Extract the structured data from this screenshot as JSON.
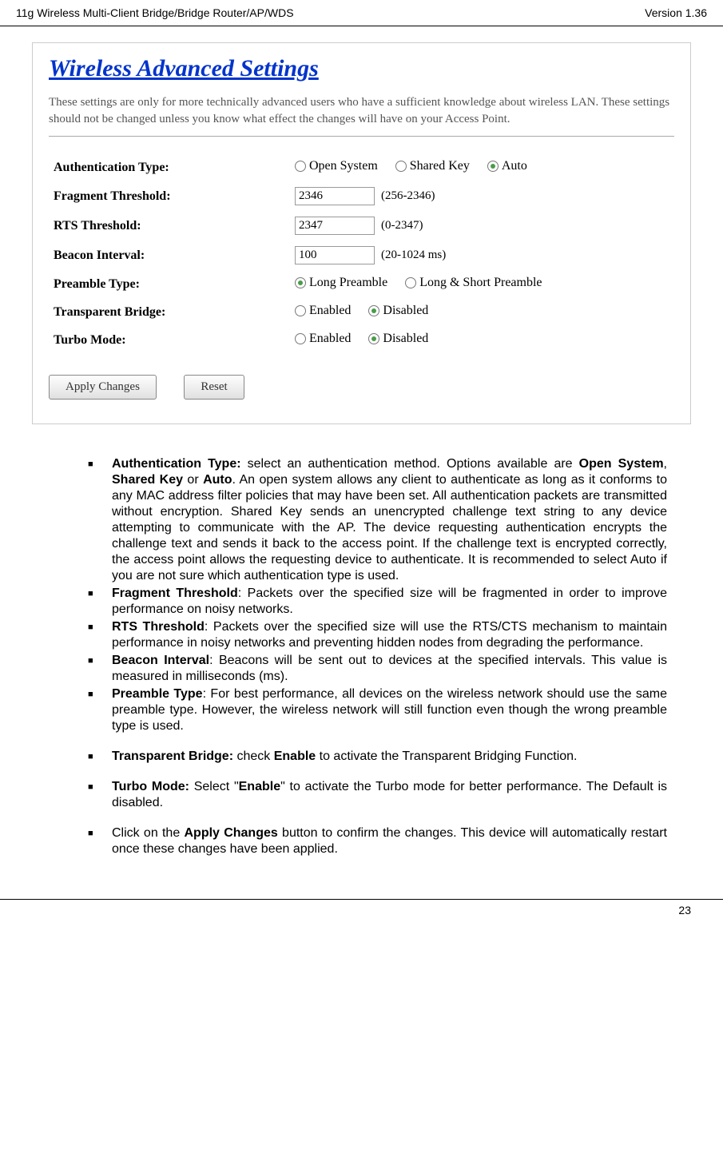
{
  "header": {
    "left": "11g Wireless Multi-Client Bridge/Bridge Router/AP/WDS",
    "right": "Version 1.36"
  },
  "panel": {
    "title": "Wireless Advanced Settings",
    "description": "These settings are only for more technically advanced users who have a sufficient knowledge about wireless LAN. These settings should not be changed unless you know what effect the changes will have on your Access Point.",
    "rows": {
      "auth_label": "Authentication Type:",
      "auth_opts": {
        "open": "Open System",
        "shared": "Shared Key",
        "auto": "Auto"
      },
      "frag_label": "Fragment Threshold:",
      "frag_value": "2346",
      "frag_hint": "(256-2346)",
      "rts_label": "RTS Threshold:",
      "rts_value": "2347",
      "rts_hint": "(0-2347)",
      "beacon_label": "Beacon Interval:",
      "beacon_value": "100",
      "beacon_hint": "(20-1024 ms)",
      "preamble_label": "Preamble Type:",
      "preamble_opts": {
        "long": "Long Preamble",
        "longshort": "Long & Short Preamble"
      },
      "transparent_label": "Transparent Bridge:",
      "turbo_label": "Turbo Mode:",
      "enable_disable": {
        "enabled": "Enabled",
        "disabled": "Disabled"
      }
    },
    "buttons": {
      "apply": "Apply Changes",
      "reset": "Reset"
    }
  },
  "bullets": {
    "auth": {
      "b1": "Authentication Type:",
      "t1": " select an authentication method. Options available are ",
      "b2": "Open System",
      "t2": ", ",
      "b3": "Shared Key",
      "t3": " or ",
      "b4": "Auto",
      "t4": ". An open system allows any client to authenticate as long as it conforms to any MAC address filter policies that may have been set. All authentication packets are transmitted without encryption. Shared Key sends an unencrypted challenge text string to any device attempting to communicate with the AP. The device requesting authentication encrypts the challenge text and sends it back to the access point. If the challenge text is encrypted correctly, the access point allows the requesting device to authenticate. It is recommended to select Auto if you are not sure which authentication type is used."
    },
    "frag": {
      "b1": "Fragment Threshold",
      "t1": ": Packets over the specified size will be fragmented in order to improve performance on noisy networks."
    },
    "rts": {
      "b1": "RTS Threshold",
      "t1": ": Packets over the specified size will use the RTS/CTS mechanism to maintain performance in noisy networks and preventing hidden nodes from degrading the performance."
    },
    "beacon": {
      "b1": "Beacon Interval",
      "t1": ": Beacons will be sent out to devices at the specified intervals. This value is measured in milliseconds (ms)."
    },
    "preamble": {
      "b1": "Preamble Type",
      "t1": ": For best performance, all devices on the wireless network should use the same preamble type. However, the wireless network will still function even though the wrong preamble type is used."
    },
    "transparent": {
      "b1": "Transparent Bridge:",
      "t1": " check ",
      "b2": "Enable",
      "t2": " to activate the Transparent Bridging Function."
    },
    "turbo": {
      "b1": "Turbo Mode:",
      "t1": " Select \"",
      "b2": "Enable",
      "t2": "\" to activate the Turbo mode for better performance. The Default is disabled."
    },
    "apply": {
      "t1": "Click on the ",
      "b1": "Apply Changes",
      "t2": " button to confirm the changes. This device will automatically restart once these changes have been applied."
    }
  },
  "footer": {
    "page": "23"
  }
}
